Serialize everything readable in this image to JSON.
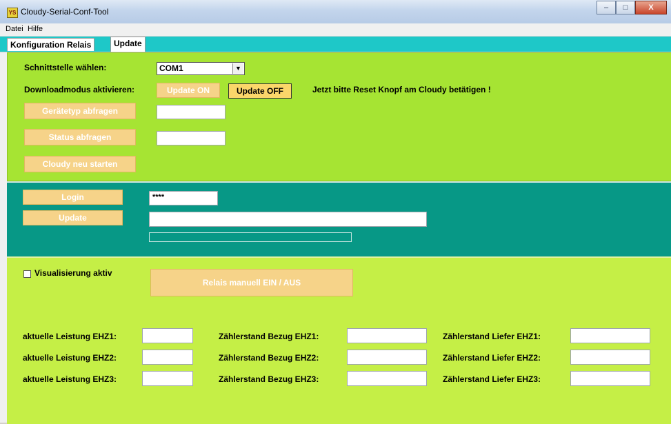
{
  "window": {
    "title": "Cloudy-Serial-Conf-Tool",
    "app_icon_text": "YS",
    "buttons": {
      "minimize": "–",
      "maximize": "□",
      "close": "X"
    }
  },
  "menu": {
    "items": [
      "Datei",
      "Hilfe"
    ]
  },
  "tabs": [
    {
      "label": "Konfiguration Relais",
      "active": false
    },
    {
      "label": "Update",
      "active": true
    }
  ],
  "section1": {
    "interface_label": "Schnittstelle wählen:",
    "interface_selected": "COM1",
    "download_label": "Downloadmodus aktivieren:",
    "update_on_label": "Update ON",
    "update_off_label": "Update OFF",
    "reset_hint": "Jetzt bitte Reset Knopf am Cloudy betätigen !",
    "device_type_button": "Gerätetyp abfragen",
    "device_type_value": "",
    "status_button": "Status abfragen",
    "status_value": "",
    "restart_button": "Cloudy neu starten"
  },
  "section2": {
    "login_button": "Login",
    "password_value": "****",
    "update_button": "Update",
    "file_path_value": "",
    "progress": 0
  },
  "section3": {
    "visualization_label": "Visualisierung aktiv",
    "visualization_checked": false,
    "relay_button": "Relais manuell EIN / AUS",
    "rows": [
      {
        "power_label": "aktuelle Leistung EHZ1:",
        "power_value": "",
        "import_label": "Zählerstand Bezug EHZ1:",
        "import_value": "",
        "export_label": "Zählerstand Liefer EHZ1:",
        "export_value": ""
      },
      {
        "power_label": "aktuelle Leistung EHZ2:",
        "power_value": "",
        "import_label": "Zählerstand Bezug EHZ2:",
        "import_value": "",
        "export_label": "Zählerstand Liefer EHZ2:",
        "export_value": ""
      },
      {
        "power_label": "aktuelle Leistung EHZ3:",
        "power_value": "",
        "import_label": "Zählerstand Bezug EHZ3:",
        "import_value": "",
        "export_label": "Zählerstand Liefer EHZ3:",
        "export_value": ""
      }
    ]
  },
  "colors": {
    "tab_strip": "#1ec8c8",
    "panel1_bg": "#a6e433",
    "panel2_bg": "#079886",
    "panel3_bg": "#c5ef46",
    "button_disabled": "#f6d389",
    "button_active": "#fbd66a"
  }
}
